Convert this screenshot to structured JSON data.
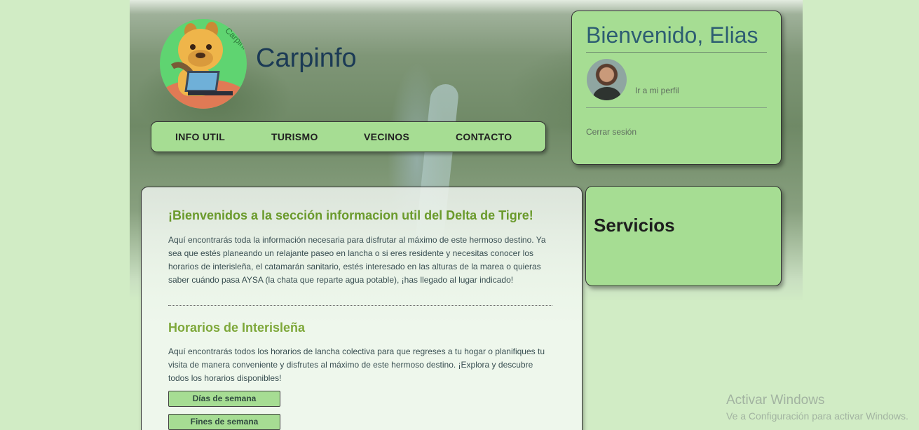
{
  "header": {
    "brand": "Carpinfo",
    "logo_text": "Carpinfo"
  },
  "nav": {
    "items": [
      "INFO UTIL",
      "TURISMO",
      "VECINOS",
      "CONTACTO"
    ]
  },
  "user_panel": {
    "greeting": "Bienvenido, Elias",
    "profile_link": "Ir a mi perfil",
    "logout_link": "Cerrar sesión"
  },
  "main": {
    "title": "¡Bienvenidos a la sección informacion util del Delta de Tigre!",
    "intro": "Aquí encontrarás toda la información necesaria para disfrutar al máximo de este hermoso destino. Ya sea que estés planeando un relajante paseo en lancha o si eres residente y necesitas conocer los horarios de interisleña, el catamarán sanitario, estés interesado en las alturas de la marea o quieras saber cuándo pasa AYSA (la chata que reparte agua potable), ¡has llegado al lugar indicado!",
    "section_title": "Horarios de Interisleña",
    "section_text": "Aquí encontrarás todos los horarios de lancha colectiva para que regreses a tu hogar o planifiques tu visita de manera conveniente y disfrutes al máximo de este hermoso destino. ¡Explora y descubre todos los horarios disponibles!",
    "buttons": [
      "Días de semana",
      "Fines de semana"
    ]
  },
  "services": {
    "title": "Servicios"
  },
  "watermark": {
    "line1": "Activar Windows",
    "line2": "Ve a Configuración para activar Windows."
  },
  "colors": {
    "panel_green": "#a6dd93",
    "page_bg": "#d1ecc5",
    "title_green": "#6a9a2b",
    "brand_blue": "#1b3a55"
  }
}
